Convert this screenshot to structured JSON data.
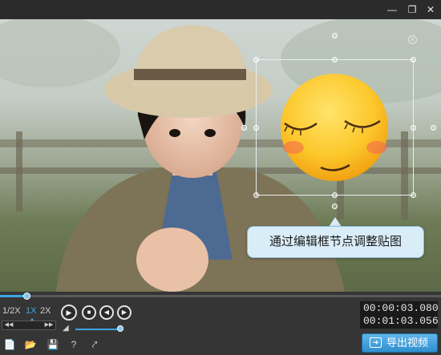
{
  "window": {
    "minimize_icon": "minimize-icon",
    "restore_icon": "restore-icon",
    "close_icon": "close-icon"
  },
  "stage": {
    "sticker_icon": "blushing-emoji-sticker",
    "tooltip_text": "通过编辑框节点调整贴图"
  },
  "player": {
    "progress": 0.06,
    "speeds": [
      "1/2X",
      "1X",
      "2X"
    ],
    "active_speed": "1X",
    "volume": 1.0,
    "current_time": "00:00:03.080",
    "total_time": "00:01:03.056"
  },
  "toolbar": {
    "icons": [
      "new-file-icon",
      "open-folder-icon",
      "save-icon",
      "help-icon",
      "share-icon"
    ]
  },
  "export": {
    "label": "导出视频"
  }
}
